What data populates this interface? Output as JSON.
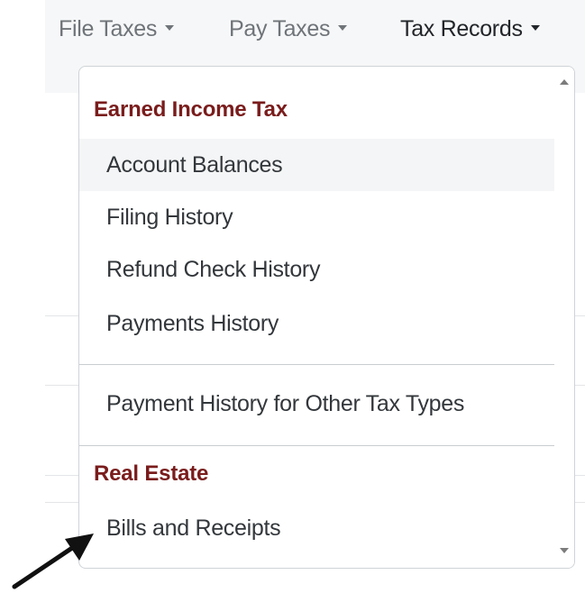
{
  "nav": {
    "items": [
      {
        "label": "File Taxes"
      },
      {
        "label": "Pay Taxes"
      },
      {
        "label": "Tax Records"
      }
    ]
  },
  "dropdown": {
    "group1": {
      "header": "Earned Income Tax",
      "items": [
        {
          "label": "Account Balances"
        },
        {
          "label": "Filing History"
        },
        {
          "label": "Refund Check History"
        },
        {
          "label": "Payments History"
        }
      ]
    },
    "other": {
      "label": "Payment History for Other Tax Types"
    },
    "group2": {
      "header": "Real Estate",
      "items": [
        {
          "label": "Bills and Receipts"
        }
      ]
    }
  },
  "colors": {
    "header_accent": "#7a1c1c",
    "nav_active": "#222529",
    "nav_inactive": "#6f7479"
  }
}
